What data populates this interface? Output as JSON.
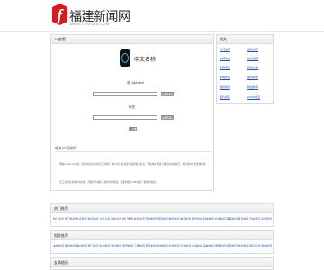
{
  "site": {
    "logo_glyph": "f",
    "title_cn": "福建新闻网",
    "title_en": "WWW.FJNEWS.COM",
    "brand_color": "#d71920"
  },
  "main": {
    "header": "1* 查看",
    "app_name": "中文名称",
    "label_1": "英: Alphabet",
    "button_1": "搜索查询",
    "label_2": "标签",
    "button_2": "搜索查询",
    "submit": "确定",
    "section_title": "相关介绍说明",
    "para_1": "　　网站(Yorke Cold)是一款非常实用好用的工具软件，用户可以在这里查看到各类信息，帮助用户快速了解相关内容资讯，支持多种方式便捷操作。",
    "para_2": "　　该工具提供多种常用功能，界面简洁清晰，操作简便快捷，需要的朋友(TM)欢迎下载体验使用。"
  },
  "sidebar": {
    "header": "相关",
    "links": [
      "热门推荐",
      "最新资讯",
      "新闻动态",
      "热点话题",
      "专题报道",
      "精选文章",
      "本地新闻",
      "国内新闻",
      "国际新闻",
      "财经新闻",
      "图片频道",
      "ZOZN频道"
    ]
  },
  "panels": [
    {
      "header": "热门推荐",
      "links": "热门资讯 热门新闻 热点新闻 新闻动态 今日头条 最新资讯 热门推荐 新闻资讯 国内新闻 国际新闻 财经新闻 体育新闻 娱乐新闻 科技新闻 社会新闻 军事新闻 教育新闻 汽车频道 房产频道 旅游频道 健康频道 时尚频道 文化频道 图片频道 视频频道 ZOZN频道"
    },
    {
      "header": "相关推荐",
      "links": "本地新闻 福建新闻 福州新闻 厦门新闻 泉州新闻 漳州新闻 莆田新闻 三明新闻 南平新闻 龙岩新闻 宁德新闻 平潭新闻 台海新闻 海峡新闻 闽南新闻 闽西新闻 闽北新闻 闽东新闻 闽中新闻 新闻热线 新闻排行 新闻专题 新闻图片 新闻视频 新闻评论"
    },
    {
      "header": "友情链接",
      "links": ""
    }
  ]
}
